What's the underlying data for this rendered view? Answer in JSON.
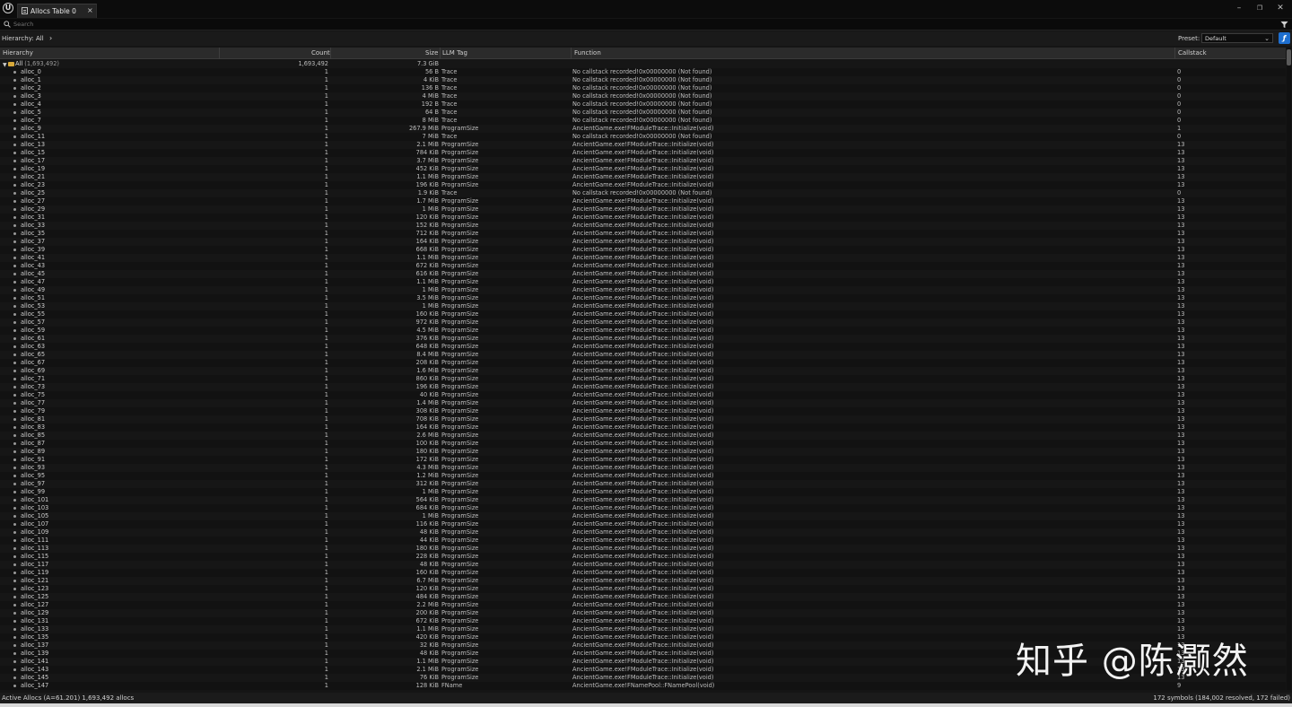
{
  "window": {
    "tab_title": "Allocs Table 0",
    "tab_close": "×",
    "logo": "U",
    "controls": {
      "minimize": "–",
      "restore": "❐",
      "close": "✕"
    }
  },
  "search": {
    "placeholder": "Search"
  },
  "hierarchy_bar": {
    "label": "Hierarchy:",
    "value": "All",
    "chevron": "›"
  },
  "preset": {
    "label": "Preset:",
    "value": "Default",
    "button_glyph": "ƒ"
  },
  "columns": {
    "hierarchy": "Hierarchy",
    "count": "Count",
    "size": "Size",
    "llm_tag": "LLM Tag",
    "function": "Function",
    "callstack": "Callstack"
  },
  "root": {
    "name": "All",
    "count_label": "(1,693,492)",
    "count": "1,693,492",
    "size": "7.3 GiB"
  },
  "rows": [
    {
      "name": "alloc_0",
      "count": "1",
      "size": "56 B",
      "tag": "Trace",
      "func": "No callstack recorded!0x00000000 (Not found)",
      "cs": "0"
    },
    {
      "name": "alloc_1",
      "count": "1",
      "size": "4 KiB",
      "tag": "Trace",
      "func": "No callstack recorded!0x00000000 (Not found)",
      "cs": "0"
    },
    {
      "name": "alloc_2",
      "count": "1",
      "size": "136 B",
      "tag": "Trace",
      "func": "No callstack recorded!0x00000000 (Not found)",
      "cs": "0"
    },
    {
      "name": "alloc_3",
      "count": "1",
      "size": "4 MiB",
      "tag": "Trace",
      "func": "No callstack recorded!0x00000000 (Not found)",
      "cs": "0"
    },
    {
      "name": "alloc_4",
      "count": "1",
      "size": "192 B",
      "tag": "Trace",
      "func": "No callstack recorded!0x00000000 (Not found)",
      "cs": "0"
    },
    {
      "name": "alloc_5",
      "count": "1",
      "size": "64 B",
      "tag": "Trace",
      "func": "No callstack recorded!0x00000000 (Not found)",
      "cs": "0"
    },
    {
      "name": "alloc_7",
      "count": "1",
      "size": "8 MiB",
      "tag": "Trace",
      "func": "No callstack recorded!0x00000000 (Not found)",
      "cs": "0"
    },
    {
      "name": "alloc_9",
      "count": "1",
      "size": "267.9 MiB",
      "tag": "ProgramSize",
      "func": "AncientGame.exe!FModuleTrace::Initialize(void)",
      "cs": "1"
    },
    {
      "name": "alloc_11",
      "count": "1",
      "size": "7 MiB",
      "tag": "Trace",
      "func": "No callstack recorded!0x00000000 (Not found)",
      "cs": "0"
    },
    {
      "name": "alloc_13",
      "count": "1",
      "size": "2.1 MiB",
      "tag": "ProgramSize",
      "func": "AncientGame.exe!FModuleTrace::Initialize(void)",
      "cs": "13"
    },
    {
      "name": "alloc_15",
      "count": "1",
      "size": "784 KiB",
      "tag": "ProgramSize",
      "func": "AncientGame.exe!FModuleTrace::Initialize(void)",
      "cs": "13"
    },
    {
      "name": "alloc_17",
      "count": "1",
      "size": "3.7 MiB",
      "tag": "ProgramSize",
      "func": "AncientGame.exe!FModuleTrace::Initialize(void)",
      "cs": "13"
    },
    {
      "name": "alloc_19",
      "count": "1",
      "size": "452 KiB",
      "tag": "ProgramSize",
      "func": "AncientGame.exe!FModuleTrace::Initialize(void)",
      "cs": "13"
    },
    {
      "name": "alloc_21",
      "count": "1",
      "size": "1.1 MiB",
      "tag": "ProgramSize",
      "func": "AncientGame.exe!FModuleTrace::Initialize(void)",
      "cs": "13"
    },
    {
      "name": "alloc_23",
      "count": "1",
      "size": "196 KiB",
      "tag": "ProgramSize",
      "func": "AncientGame.exe!FModuleTrace::Initialize(void)",
      "cs": "13"
    },
    {
      "name": "alloc_25",
      "count": "1",
      "size": "1.9 KiB",
      "tag": "Trace",
      "func": "No callstack recorded!0x00000000 (Not found)",
      "cs": "0"
    },
    {
      "name": "alloc_27",
      "count": "1",
      "size": "1.7 MiB",
      "tag": "ProgramSize",
      "func": "AncientGame.exe!FModuleTrace::Initialize(void)",
      "cs": "13"
    },
    {
      "name": "alloc_29",
      "count": "1",
      "size": "1 MiB",
      "tag": "ProgramSize",
      "func": "AncientGame.exe!FModuleTrace::Initialize(void)",
      "cs": "13"
    },
    {
      "name": "alloc_31",
      "count": "1",
      "size": "120 KiB",
      "tag": "ProgramSize",
      "func": "AncientGame.exe!FModuleTrace::Initialize(void)",
      "cs": "13"
    },
    {
      "name": "alloc_33",
      "count": "1",
      "size": "152 KiB",
      "tag": "ProgramSize",
      "func": "AncientGame.exe!FModuleTrace::Initialize(void)",
      "cs": "13"
    },
    {
      "name": "alloc_35",
      "count": "1",
      "size": "712 KiB",
      "tag": "ProgramSize",
      "func": "AncientGame.exe!FModuleTrace::Initialize(void)",
      "cs": "13"
    },
    {
      "name": "alloc_37",
      "count": "1",
      "size": "164 KiB",
      "tag": "ProgramSize",
      "func": "AncientGame.exe!FModuleTrace::Initialize(void)",
      "cs": "13"
    },
    {
      "name": "alloc_39",
      "count": "1",
      "size": "668 KiB",
      "tag": "ProgramSize",
      "func": "AncientGame.exe!FModuleTrace::Initialize(void)",
      "cs": "13"
    },
    {
      "name": "alloc_41",
      "count": "1",
      "size": "1.1 MiB",
      "tag": "ProgramSize",
      "func": "AncientGame.exe!FModuleTrace::Initialize(void)",
      "cs": "13"
    },
    {
      "name": "alloc_43",
      "count": "1",
      "size": "672 KiB",
      "tag": "ProgramSize",
      "func": "AncientGame.exe!FModuleTrace::Initialize(void)",
      "cs": "13"
    },
    {
      "name": "alloc_45",
      "count": "1",
      "size": "616 KiB",
      "tag": "ProgramSize",
      "func": "AncientGame.exe!FModuleTrace::Initialize(void)",
      "cs": "13"
    },
    {
      "name": "alloc_47",
      "count": "1",
      "size": "1.1 MiB",
      "tag": "ProgramSize",
      "func": "AncientGame.exe!FModuleTrace::Initialize(void)",
      "cs": "13"
    },
    {
      "name": "alloc_49",
      "count": "1",
      "size": "1 MiB",
      "tag": "ProgramSize",
      "func": "AncientGame.exe!FModuleTrace::Initialize(void)",
      "cs": "13"
    },
    {
      "name": "alloc_51",
      "count": "1",
      "size": "3.5 MiB",
      "tag": "ProgramSize",
      "func": "AncientGame.exe!FModuleTrace::Initialize(void)",
      "cs": "13"
    },
    {
      "name": "alloc_53",
      "count": "1",
      "size": "1 MiB",
      "tag": "ProgramSize",
      "func": "AncientGame.exe!FModuleTrace::Initialize(void)",
      "cs": "13"
    },
    {
      "name": "alloc_55",
      "count": "1",
      "size": "160 KiB",
      "tag": "ProgramSize",
      "func": "AncientGame.exe!FModuleTrace::Initialize(void)",
      "cs": "13"
    },
    {
      "name": "alloc_57",
      "count": "1",
      "size": "972 KiB",
      "tag": "ProgramSize",
      "func": "AncientGame.exe!FModuleTrace::Initialize(void)",
      "cs": "13"
    },
    {
      "name": "alloc_59",
      "count": "1",
      "size": "4.5 MiB",
      "tag": "ProgramSize",
      "func": "AncientGame.exe!FModuleTrace::Initialize(void)",
      "cs": "13"
    },
    {
      "name": "alloc_61",
      "count": "1",
      "size": "376 KiB",
      "tag": "ProgramSize",
      "func": "AncientGame.exe!FModuleTrace::Initialize(void)",
      "cs": "13"
    },
    {
      "name": "alloc_63",
      "count": "1",
      "size": "648 KiB",
      "tag": "ProgramSize",
      "func": "AncientGame.exe!FModuleTrace::Initialize(void)",
      "cs": "13"
    },
    {
      "name": "alloc_65",
      "count": "1",
      "size": "8.4 MiB",
      "tag": "ProgramSize",
      "func": "AncientGame.exe!FModuleTrace::Initialize(void)",
      "cs": "13"
    },
    {
      "name": "alloc_67",
      "count": "1",
      "size": "208 KiB",
      "tag": "ProgramSize",
      "func": "AncientGame.exe!FModuleTrace::Initialize(void)",
      "cs": "13"
    },
    {
      "name": "alloc_69",
      "count": "1",
      "size": "1.6 MiB",
      "tag": "ProgramSize",
      "func": "AncientGame.exe!FModuleTrace::Initialize(void)",
      "cs": "13"
    },
    {
      "name": "alloc_71",
      "count": "1",
      "size": "860 KiB",
      "tag": "ProgramSize",
      "func": "AncientGame.exe!FModuleTrace::Initialize(void)",
      "cs": "13"
    },
    {
      "name": "alloc_73",
      "count": "1",
      "size": "196 KiB",
      "tag": "ProgramSize",
      "func": "AncientGame.exe!FModuleTrace::Initialize(void)",
      "cs": "13"
    },
    {
      "name": "alloc_75",
      "count": "1",
      "size": "40 KiB",
      "tag": "ProgramSize",
      "func": "AncientGame.exe!FModuleTrace::Initialize(void)",
      "cs": "13"
    },
    {
      "name": "alloc_77",
      "count": "1",
      "size": "1.4 MiB",
      "tag": "ProgramSize",
      "func": "AncientGame.exe!FModuleTrace::Initialize(void)",
      "cs": "13"
    },
    {
      "name": "alloc_79",
      "count": "1",
      "size": "308 KiB",
      "tag": "ProgramSize",
      "func": "AncientGame.exe!FModuleTrace::Initialize(void)",
      "cs": "13"
    },
    {
      "name": "alloc_81",
      "count": "1",
      "size": "708 KiB",
      "tag": "ProgramSize",
      "func": "AncientGame.exe!FModuleTrace::Initialize(void)",
      "cs": "13"
    },
    {
      "name": "alloc_83",
      "count": "1",
      "size": "164 KiB",
      "tag": "ProgramSize",
      "func": "AncientGame.exe!FModuleTrace::Initialize(void)",
      "cs": "13"
    },
    {
      "name": "alloc_85",
      "count": "1",
      "size": "2.6 MiB",
      "tag": "ProgramSize",
      "func": "AncientGame.exe!FModuleTrace::Initialize(void)",
      "cs": "13"
    },
    {
      "name": "alloc_87",
      "count": "1",
      "size": "100 KiB",
      "tag": "ProgramSize",
      "func": "AncientGame.exe!FModuleTrace::Initialize(void)",
      "cs": "13"
    },
    {
      "name": "alloc_89",
      "count": "1",
      "size": "180 KiB",
      "tag": "ProgramSize",
      "func": "AncientGame.exe!FModuleTrace::Initialize(void)",
      "cs": "13"
    },
    {
      "name": "alloc_91",
      "count": "1",
      "size": "172 KiB",
      "tag": "ProgramSize",
      "func": "AncientGame.exe!FModuleTrace::Initialize(void)",
      "cs": "13"
    },
    {
      "name": "alloc_93",
      "count": "1",
      "size": "4.3 MiB",
      "tag": "ProgramSize",
      "func": "AncientGame.exe!FModuleTrace::Initialize(void)",
      "cs": "13"
    },
    {
      "name": "alloc_95",
      "count": "1",
      "size": "1.2 MiB",
      "tag": "ProgramSize",
      "func": "AncientGame.exe!FModuleTrace::Initialize(void)",
      "cs": "13"
    },
    {
      "name": "alloc_97",
      "count": "1",
      "size": "312 KiB",
      "tag": "ProgramSize",
      "func": "AncientGame.exe!FModuleTrace::Initialize(void)",
      "cs": "13"
    },
    {
      "name": "alloc_99",
      "count": "1",
      "size": "1 MiB",
      "tag": "ProgramSize",
      "func": "AncientGame.exe!FModuleTrace::Initialize(void)",
      "cs": "13"
    },
    {
      "name": "alloc_101",
      "count": "1",
      "size": "564 KiB",
      "tag": "ProgramSize",
      "func": "AncientGame.exe!FModuleTrace::Initialize(void)",
      "cs": "13"
    },
    {
      "name": "alloc_103",
      "count": "1",
      "size": "684 KiB",
      "tag": "ProgramSize",
      "func": "AncientGame.exe!FModuleTrace::Initialize(void)",
      "cs": "13"
    },
    {
      "name": "alloc_105",
      "count": "1",
      "size": "1 MiB",
      "tag": "ProgramSize",
      "func": "AncientGame.exe!FModuleTrace::Initialize(void)",
      "cs": "13"
    },
    {
      "name": "alloc_107",
      "count": "1",
      "size": "116 KiB",
      "tag": "ProgramSize",
      "func": "AncientGame.exe!FModuleTrace::Initialize(void)",
      "cs": "13"
    },
    {
      "name": "alloc_109",
      "count": "1",
      "size": "48 KiB",
      "tag": "ProgramSize",
      "func": "AncientGame.exe!FModuleTrace::Initialize(void)",
      "cs": "13"
    },
    {
      "name": "alloc_111",
      "count": "1",
      "size": "44 KiB",
      "tag": "ProgramSize",
      "func": "AncientGame.exe!FModuleTrace::Initialize(void)",
      "cs": "13"
    },
    {
      "name": "alloc_113",
      "count": "1",
      "size": "180 KiB",
      "tag": "ProgramSize",
      "func": "AncientGame.exe!FModuleTrace::Initialize(void)",
      "cs": "13"
    },
    {
      "name": "alloc_115",
      "count": "1",
      "size": "228 KiB",
      "tag": "ProgramSize",
      "func": "AncientGame.exe!FModuleTrace::Initialize(void)",
      "cs": "13"
    },
    {
      "name": "alloc_117",
      "count": "1",
      "size": "48 KiB",
      "tag": "ProgramSize",
      "func": "AncientGame.exe!FModuleTrace::Initialize(void)",
      "cs": "13"
    },
    {
      "name": "alloc_119",
      "count": "1",
      "size": "160 KiB",
      "tag": "ProgramSize",
      "func": "AncientGame.exe!FModuleTrace::Initialize(void)",
      "cs": "13"
    },
    {
      "name": "alloc_121",
      "count": "1",
      "size": "6.7 MiB",
      "tag": "ProgramSize",
      "func": "AncientGame.exe!FModuleTrace::Initialize(void)",
      "cs": "13"
    },
    {
      "name": "alloc_123",
      "count": "1",
      "size": "120 KiB",
      "tag": "ProgramSize",
      "func": "AncientGame.exe!FModuleTrace::Initialize(void)",
      "cs": "13"
    },
    {
      "name": "alloc_125",
      "count": "1",
      "size": "484 KiB",
      "tag": "ProgramSize",
      "func": "AncientGame.exe!FModuleTrace::Initialize(void)",
      "cs": "13"
    },
    {
      "name": "alloc_127",
      "count": "1",
      "size": "2.2 MiB",
      "tag": "ProgramSize",
      "func": "AncientGame.exe!FModuleTrace::Initialize(void)",
      "cs": "13"
    },
    {
      "name": "alloc_129",
      "count": "1",
      "size": "200 KiB",
      "tag": "ProgramSize",
      "func": "AncientGame.exe!FModuleTrace::Initialize(void)",
      "cs": "13"
    },
    {
      "name": "alloc_131",
      "count": "1",
      "size": "672 KiB",
      "tag": "ProgramSize",
      "func": "AncientGame.exe!FModuleTrace::Initialize(void)",
      "cs": "13"
    },
    {
      "name": "alloc_133",
      "count": "1",
      "size": "1.1 MiB",
      "tag": "ProgramSize",
      "func": "AncientGame.exe!FModuleTrace::Initialize(void)",
      "cs": "13"
    },
    {
      "name": "alloc_135",
      "count": "1",
      "size": "420 KiB",
      "tag": "ProgramSize",
      "func": "AncientGame.exe!FModuleTrace::Initialize(void)",
      "cs": "13"
    },
    {
      "name": "alloc_137",
      "count": "1",
      "size": "32 KiB",
      "tag": "ProgramSize",
      "func": "AncientGame.exe!FModuleTrace::Initialize(void)",
      "cs": "13"
    },
    {
      "name": "alloc_139",
      "count": "1",
      "size": "48 KiB",
      "tag": "ProgramSize",
      "func": "AncientGame.exe!FModuleTrace::Initialize(void)",
      "cs": "13"
    },
    {
      "name": "alloc_141",
      "count": "1",
      "size": "1.1 MiB",
      "tag": "ProgramSize",
      "func": "AncientGame.exe!FModuleTrace::Initialize(void)",
      "cs": "13"
    },
    {
      "name": "alloc_143",
      "count": "1",
      "size": "2.1 MiB",
      "tag": "ProgramSize",
      "func": "AncientGame.exe!FModuleTrace::Initialize(void)",
      "cs": "13"
    },
    {
      "name": "alloc_145",
      "count": "1",
      "size": "76 KiB",
      "tag": "ProgramSize",
      "func": "AncientGame.exe!FModuleTrace::Initialize(void)",
      "cs": "13"
    },
    {
      "name": "alloc_147",
      "count": "1",
      "size": "128 KiB",
      "tag": "FName",
      "func": "AncientGame.exe!FNamePool::FNamePool(void)",
      "cs": "9"
    }
  ],
  "status": {
    "left": "Active Allocs (A=61.201)   1,693,492 allocs",
    "right": "172 symbols (184,002 resolved, 172 failed)"
  },
  "watermark": "知乎 @陈灏然"
}
